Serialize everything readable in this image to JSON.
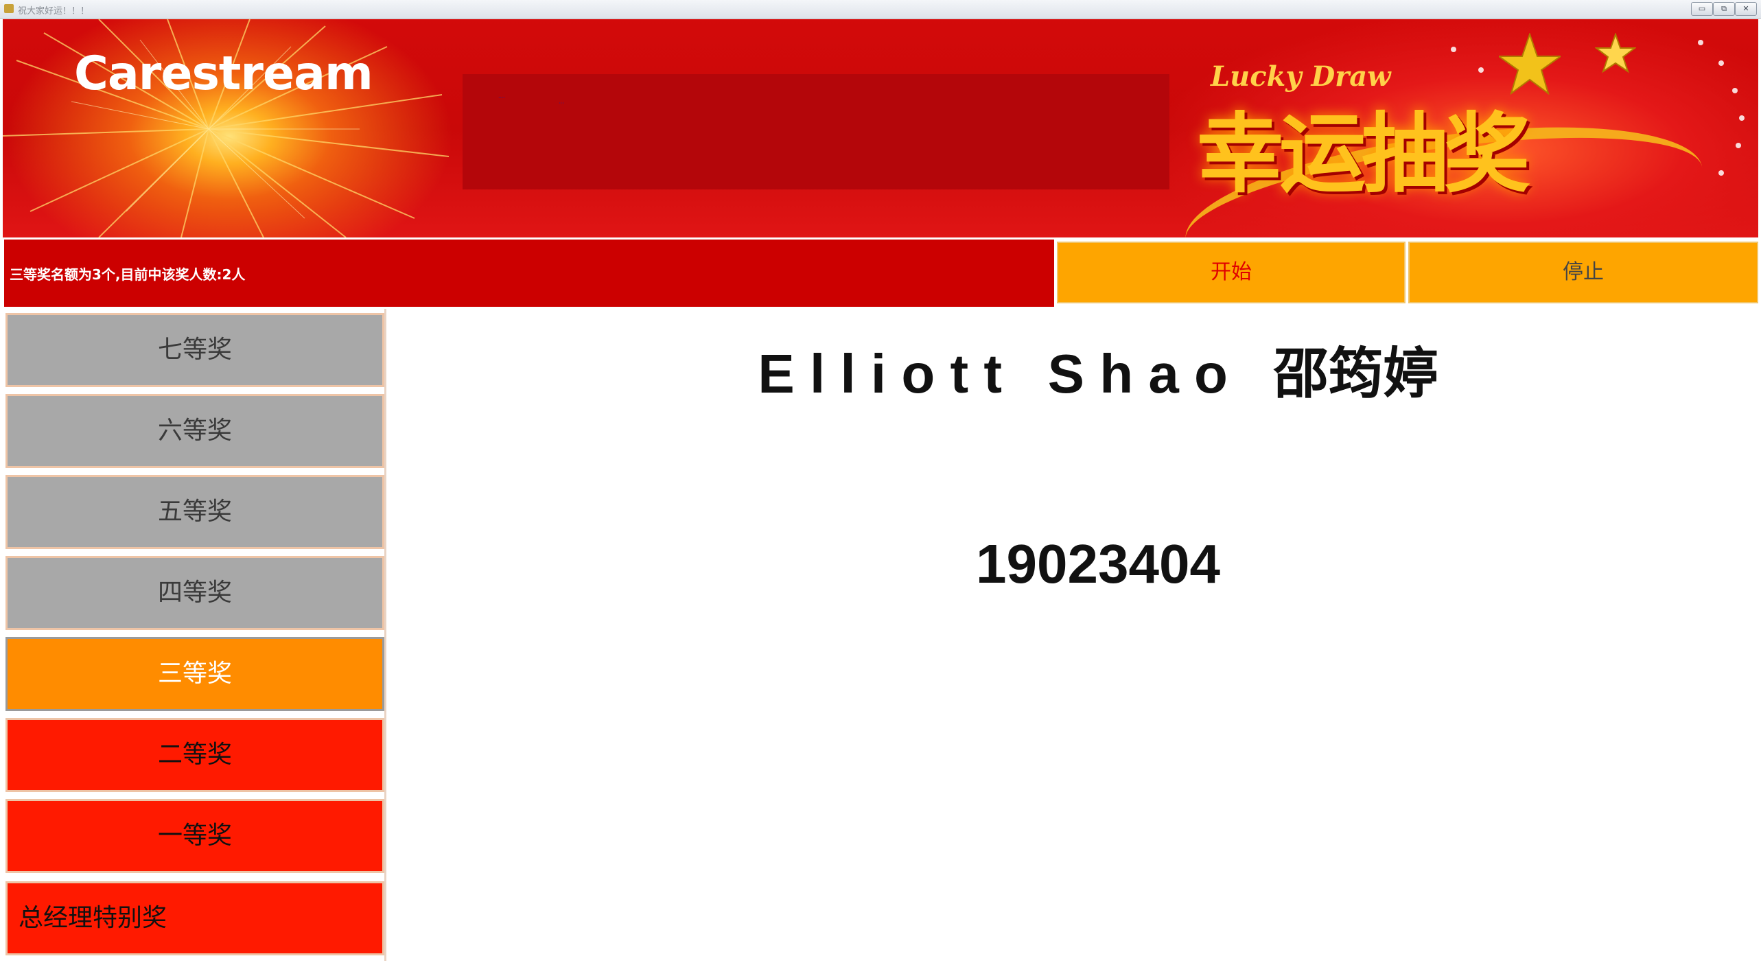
{
  "window": {
    "title": "祝大家好运！！！",
    "controls": [
      "minimize-icon",
      "restore-icon",
      "close-icon"
    ]
  },
  "banner": {
    "logo": "Carestream",
    "lucky_draw": "Lucky Draw",
    "cn_title": "幸运抽奖"
  },
  "status": {
    "text": "三等奖名额为3个,目前中该奖人数:2人"
  },
  "controls": {
    "start_label": "开始",
    "stop_label": "停止"
  },
  "prizes": [
    {
      "label": "七等奖",
      "state": "inactive"
    },
    {
      "label": "六等奖",
      "state": "inactive"
    },
    {
      "label": "五等奖",
      "state": "inactive"
    },
    {
      "label": "四等奖",
      "state": "inactive"
    },
    {
      "label": "三等奖",
      "state": "selected"
    },
    {
      "label": "二等奖",
      "state": "pending"
    },
    {
      "label": "一等奖",
      "state": "pending"
    },
    {
      "label": "总经理特别奖",
      "state": "pending"
    }
  ],
  "result": {
    "name": "E l l i o t t   S h a o   邵筠婷",
    "id": "19023404"
  },
  "colors": {
    "banner_red": "#cc0000",
    "button_orange": "#fea500",
    "selected_orange": "#ff8c00",
    "inactive_gray": "#a8a8a8",
    "pending_red": "#ff1a00"
  }
}
